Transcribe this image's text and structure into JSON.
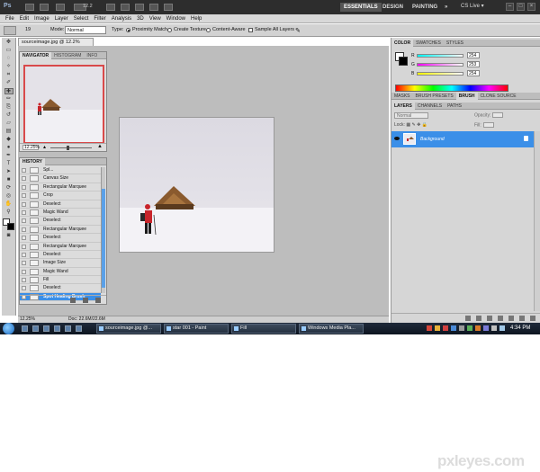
{
  "app": {
    "logo": "Ps",
    "zoom_level": "12.2",
    "workspaces": [
      "ESSENTIALS",
      "DESIGN",
      "PAINTING",
      "»"
    ],
    "active_workspace": "ESSENTIALS",
    "cs_live": "CS Live ▾"
  },
  "menu": [
    "File",
    "Edit",
    "Image",
    "Layer",
    "Select",
    "Filter",
    "Analysis",
    "3D",
    "View",
    "Window",
    "Help"
  ],
  "options": {
    "brush_size": "19",
    "mode_label": "Mode:",
    "mode_value": "Normal",
    "type_label": "Type:",
    "type_options": [
      "Proximity Match",
      "Create Texture",
      "Content-Aware"
    ],
    "sample_all": "Sample All Layers"
  },
  "document": {
    "tab_title": "sourceimage.jpg @ 12.2% (RGB/8#)"
  },
  "navigator": {
    "tabs": [
      "NAVIGATOR",
      "HISTOGRAM",
      "INFO"
    ],
    "zoom": "12.25%"
  },
  "history": {
    "tabs": [
      "HISTORY"
    ],
    "items": [
      "Spl...",
      "Canvas Size",
      "Rectangular Marquee",
      "Crop",
      "Deselect",
      "Magic Wand",
      "Deselect",
      "Rectangular Marquee",
      "Deselect",
      "Rectangular Marquee",
      "Deselect",
      "Image Size",
      "Magic Wand",
      "Fill",
      "Deselect",
      "Spot Healing Brush"
    ],
    "selected": "Spot Healing Brush"
  },
  "status": {
    "zoom": "12.25%",
    "doc": "Doc: 22.6M/22.6M"
  },
  "color_panel": {
    "tabs": [
      "COLOR",
      "SWATCHES",
      "STYLES"
    ],
    "channels": [
      {
        "label": "R",
        "value": "254",
        "color": "#e03030"
      },
      {
        "label": "G",
        "value": "253",
        "color": "#30b030"
      },
      {
        "label": "B",
        "value": "254",
        "color": "#3060e0"
      }
    ]
  },
  "adjust_panel": {
    "tabs": [
      "MASKS",
      "BRUSH PRESETS",
      "BRUSH",
      "CLONE SOURCE"
    ]
  },
  "layers_panel": {
    "tabs": [
      "LAYERS",
      "CHANNELS",
      "PATHS"
    ],
    "blend_mode": "Normal",
    "opacity_label": "Opacity:",
    "lock_label": "Lock:",
    "fill_label": "Fill:",
    "layers": [
      "Background"
    ]
  },
  "taskbar": {
    "tasks": [
      "sourceimage.jpg @...",
      "star 001 - Paint",
      "Fill",
      "Windows Media Pla..."
    ],
    "clock": "4:34 PM"
  },
  "watermark": "pxleyes.com"
}
